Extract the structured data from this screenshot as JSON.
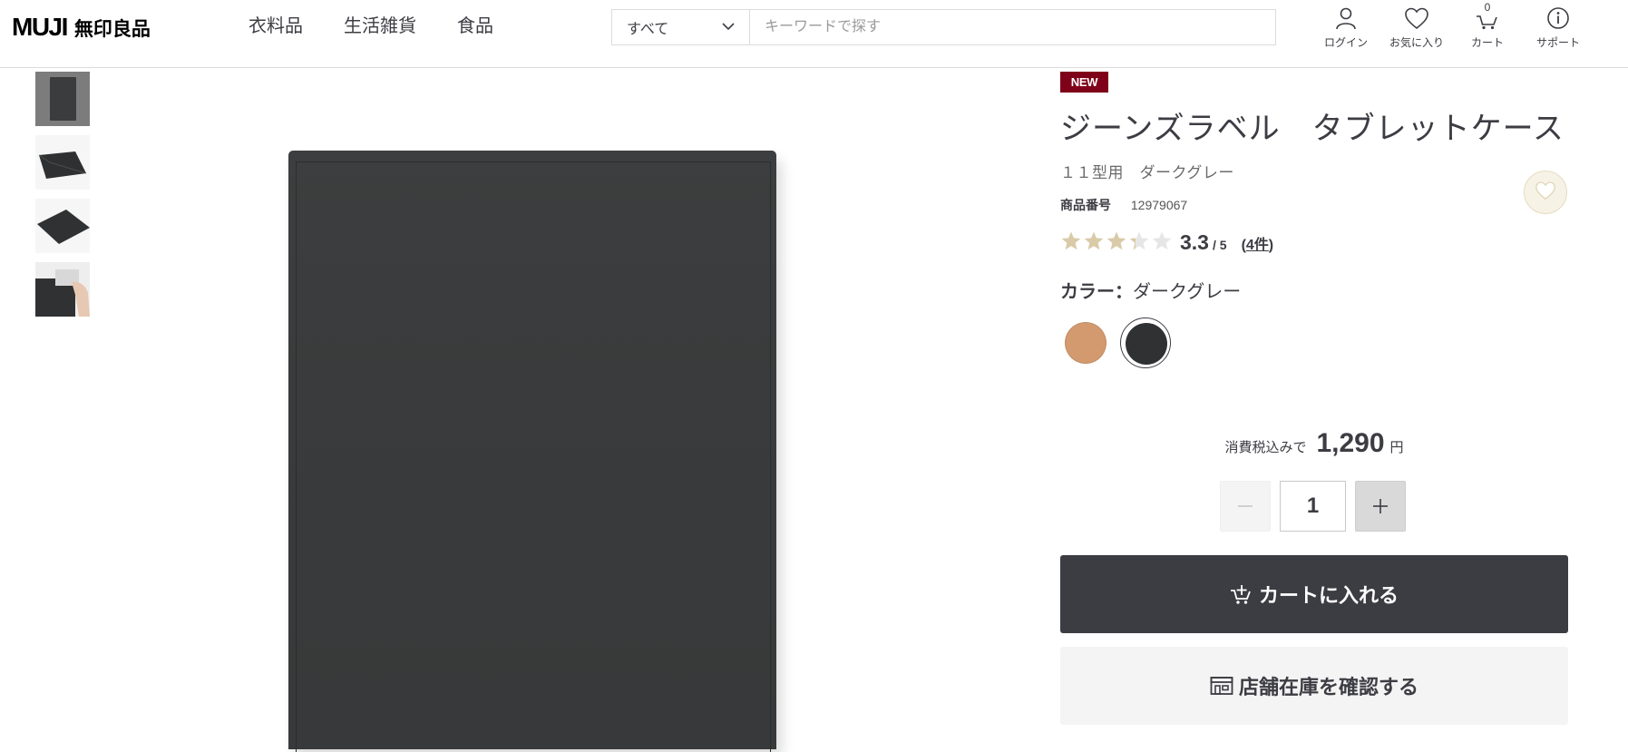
{
  "header": {
    "logo_en": "MUJI",
    "logo_jp": "無印良品",
    "nav": [
      "衣料品",
      "生活雑貨",
      "食品"
    ],
    "search": {
      "category": "すべて",
      "placeholder": "キーワードで探す"
    },
    "icons": [
      {
        "label": "ログイン",
        "icon": "person-icon"
      },
      {
        "label": "お気に入り",
        "icon": "heart-icon"
      },
      {
        "label": "カート",
        "icon": "cart-icon",
        "count": "0"
      },
      {
        "label": "サポート",
        "icon": "info-icon"
      }
    ]
  },
  "gallery": {
    "thumbnail_count": 4,
    "active_index": 0,
    "main_image": "dark grey tablet case"
  },
  "product": {
    "badge": "NEW",
    "title": "ジーンズラベル　タブレットケース",
    "subtitle": "１１型用　ダークグレー",
    "product_number_label": "商品番号",
    "product_number": "12979067",
    "rating": {
      "value": "3.3",
      "max": "/ 5",
      "count": "4件",
      "stars_filled": 3.3,
      "stars_total": 5
    },
    "color_label": "カラー：",
    "color_value": "ダークグレー",
    "swatches": [
      {
        "color": "#d29a6e",
        "selected": false
      },
      {
        "color": "#2f3132",
        "selected": true
      }
    ],
    "price_prefix": "消費税込みで",
    "price": "1,290",
    "price_unit": "円",
    "quantity": "1",
    "add_to_cart_label": "カートに入れる",
    "check_store_label": "店舗在庫を確認する"
  },
  "colors": {
    "badge_bg": "#7f0019",
    "text_main": "#3c3c43",
    "star_filled": "#d9cba8",
    "star_empty": "#e6e6e6",
    "favorite_bg": "#f7f2e6"
  }
}
